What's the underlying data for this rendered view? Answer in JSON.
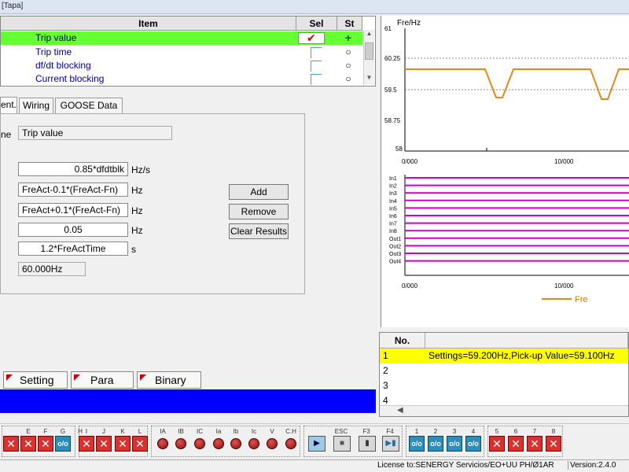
{
  "window": {
    "title": "[Tapa]"
  },
  "grid": {
    "headers": {
      "item": "Item",
      "sel": "Sel",
      "st": "St"
    },
    "rows": [
      {
        "item": "Trip value",
        "sel_mark": "✔",
        "st_mark": "+"
      },
      {
        "item": "Trip time",
        "sel_mark": "",
        "st_mark": "○"
      },
      {
        "item": "df/dt blocking",
        "sel_mark": "",
        "st_mark": "○"
      },
      {
        "item": "Current blocking",
        "sel_mark": "",
        "st_mark": "○"
      }
    ]
  },
  "tabs": {
    "t1": "ent.",
    "t2": "Wiring",
    "t3": "GOOSE Data"
  },
  "form": {
    "name_label": "ne",
    "name_value": "Trip value",
    "fields": [
      {
        "value": "0.85*dfdtblk",
        "unit": "Hz/s"
      },
      {
        "value": "FreAct-0.1*(FreAct-Fn)",
        "unit": "Hz"
      },
      {
        "value": "FreAct+0.1*(FreAct-Fn)",
        "unit": "Hz"
      },
      {
        "value": "0.05",
        "unit": "Hz"
      },
      {
        "value": "1.2*FreActTime",
        "unit": "s"
      }
    ],
    "readout": "60.000Hz",
    "buttons": {
      "add": "Add",
      "remove": "Remove",
      "clear": "Clear Results"
    }
  },
  "bottom_tabs": {
    "setting": "Setting",
    "para": "Para",
    "binary": "Binary"
  },
  "chart_top": {
    "ylabel": "Fre/Hz",
    "yticks": [
      "61",
      "60.25",
      "59.5",
      "58.75",
      "58"
    ],
    "xticks": [
      "0/000",
      "10/000"
    ]
  },
  "chart_bottom": {
    "channels": [
      "In1",
      "In2",
      "In3",
      "In4",
      "In5",
      "In6",
      "In7",
      "In8",
      "Out1",
      "Out2",
      "Out3",
      "Out4"
    ],
    "xticks": [
      "0/000",
      "10/000"
    ],
    "legend": "Fre"
  },
  "colors": {
    "trace": "#e08a1e",
    "digital": "#cc00cc",
    "selected_row": "#66ff33",
    "result_highlight": "#ffff00"
  },
  "results": {
    "header": "No.",
    "rows": [
      {
        "no": "1",
        "text": "Settings=59.200Hz,Pick-up Value=59.100Hz"
      },
      {
        "no": "2",
        "text": ""
      },
      {
        "no": "3",
        "text": ""
      },
      {
        "no": "4",
        "text": ""
      }
    ]
  },
  "toolbar": {
    "inputs": [
      "E",
      "F",
      "G",
      "H",
      "I",
      "J",
      "K",
      "L"
    ],
    "analog": [
      "IA",
      "IB",
      "IC",
      "Ia",
      "Ib",
      "Ic",
      "V",
      "C.H"
    ],
    "run_labels": [
      "",
      "ESC",
      "F3",
      "F4"
    ],
    "outputs_a": [
      "1",
      "2",
      "3",
      "4"
    ],
    "outputs_b": [
      "5",
      "6",
      "7",
      "8"
    ]
  },
  "status": {
    "license": "License to:SENERGY Servicios/EO+UU PH/Ø1AR",
    "version": "Version:2.4.0"
  }
}
